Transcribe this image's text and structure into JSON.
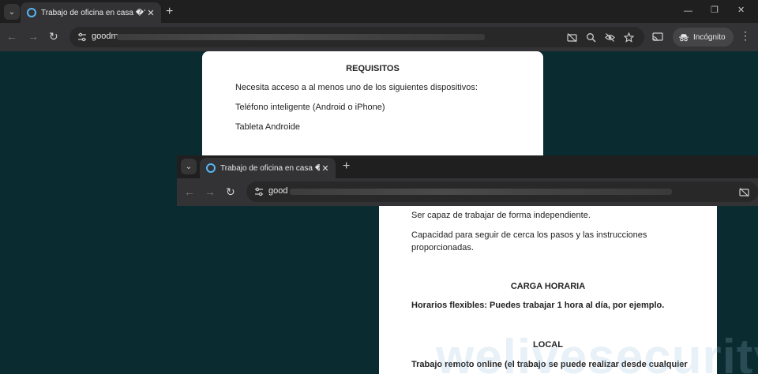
{
  "back_window": {
    "tab": {
      "title": "Trabajo de oficina en casa �?Vá"
    },
    "toolbar": {
      "url_visible": "goodm",
      "incognito_label": "Incógnito"
    },
    "page": {
      "heading": "REQUISITOS",
      "items": [
        "Necesita acceso a al menos uno de los siguientes dispositivos:",
        "Teléfono inteligente (Android o iPhone)",
        "Tableta Androide"
      ]
    }
  },
  "front_window": {
    "tab": {
      "title": "Trabajo de oficina en casa �?Vá"
    },
    "toolbar": {
      "url_visible": "good"
    },
    "page": {
      "para1": "Ser capaz de trabajar de forma independiente.",
      "para2_line1": "Capacidad para seguir de cerca los pasos y las instrucciones",
      "para2_line2": "proporcionadas.",
      "heading_hours": "CARGA HORARIA",
      "hours_text": "Horarios flexibles: Puedes trabajar 1 hora al día, por ejemplo.",
      "heading_local": "LOCAL",
      "local_text": "Trabajo remoto online (el trabajo se puede realizar desde cualquier"
    }
  },
  "watermark": "welivesecurity"
}
